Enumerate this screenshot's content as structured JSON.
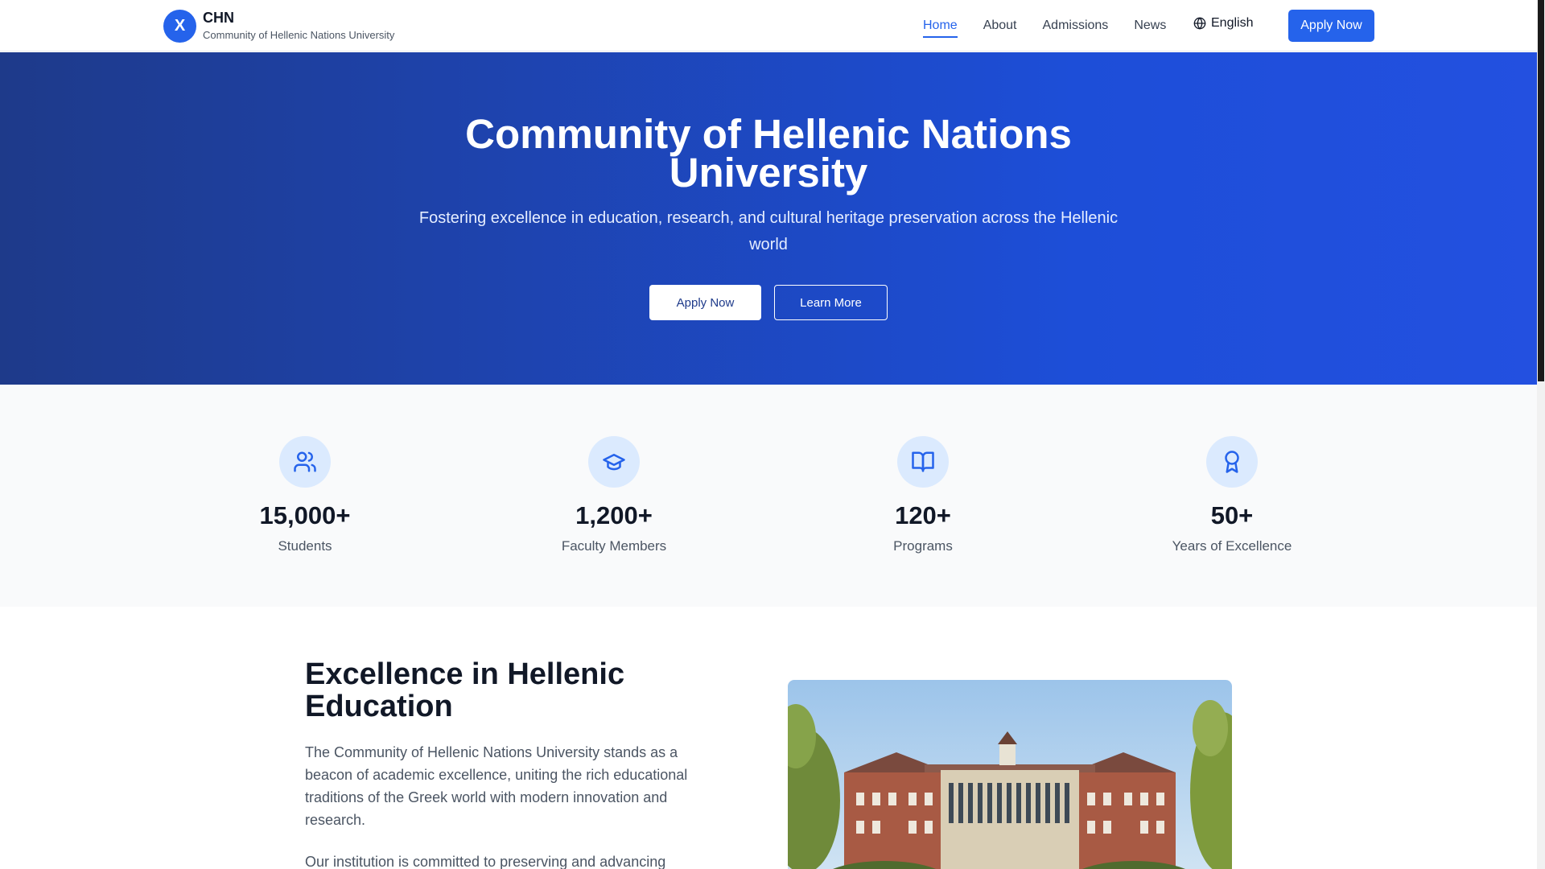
{
  "header": {
    "logo_letter": "X",
    "brand_short": "CHN",
    "brand_full": "Community of Hellenic Nations University",
    "nav": [
      {
        "label": "Home",
        "active": true
      },
      {
        "label": "About",
        "active": false
      },
      {
        "label": "Admissions",
        "active": false
      },
      {
        "label": "News",
        "active": false
      }
    ],
    "language": "English",
    "apply_label": "Apply Now"
  },
  "hero": {
    "title_line1": "Community of Hellenic Nations",
    "title_line2": "University",
    "subtitle": "Fostering excellence in education, research, and cultural heritage preservation across the Hellenic world",
    "primary_button": "Apply Now",
    "secondary_button": "Learn More"
  },
  "stats": [
    {
      "icon": "users-icon",
      "value": "15,000+",
      "label": "Students"
    },
    {
      "icon": "graduation-cap-icon",
      "value": "1,200+",
      "label": "Faculty Members"
    },
    {
      "icon": "book-open-icon",
      "value": "120+",
      "label": "Programs"
    },
    {
      "icon": "award-icon",
      "value": "50+",
      "label": "Years of Excellence"
    }
  ],
  "about": {
    "title": "Excellence in Hellenic Education",
    "paragraph1": "The Community of Hellenic Nations University stands as a beacon of academic excellence, uniting the rich educational traditions of the Greek world with modern innovation and research.",
    "paragraph2": "Our institution is committed to preserving and advancing"
  },
  "colors": {
    "accent": "#2563eb",
    "hero_start": "#1e3a8a",
    "hero_end": "#1d4ed8",
    "stat_icon_bg": "#dbeafe"
  }
}
